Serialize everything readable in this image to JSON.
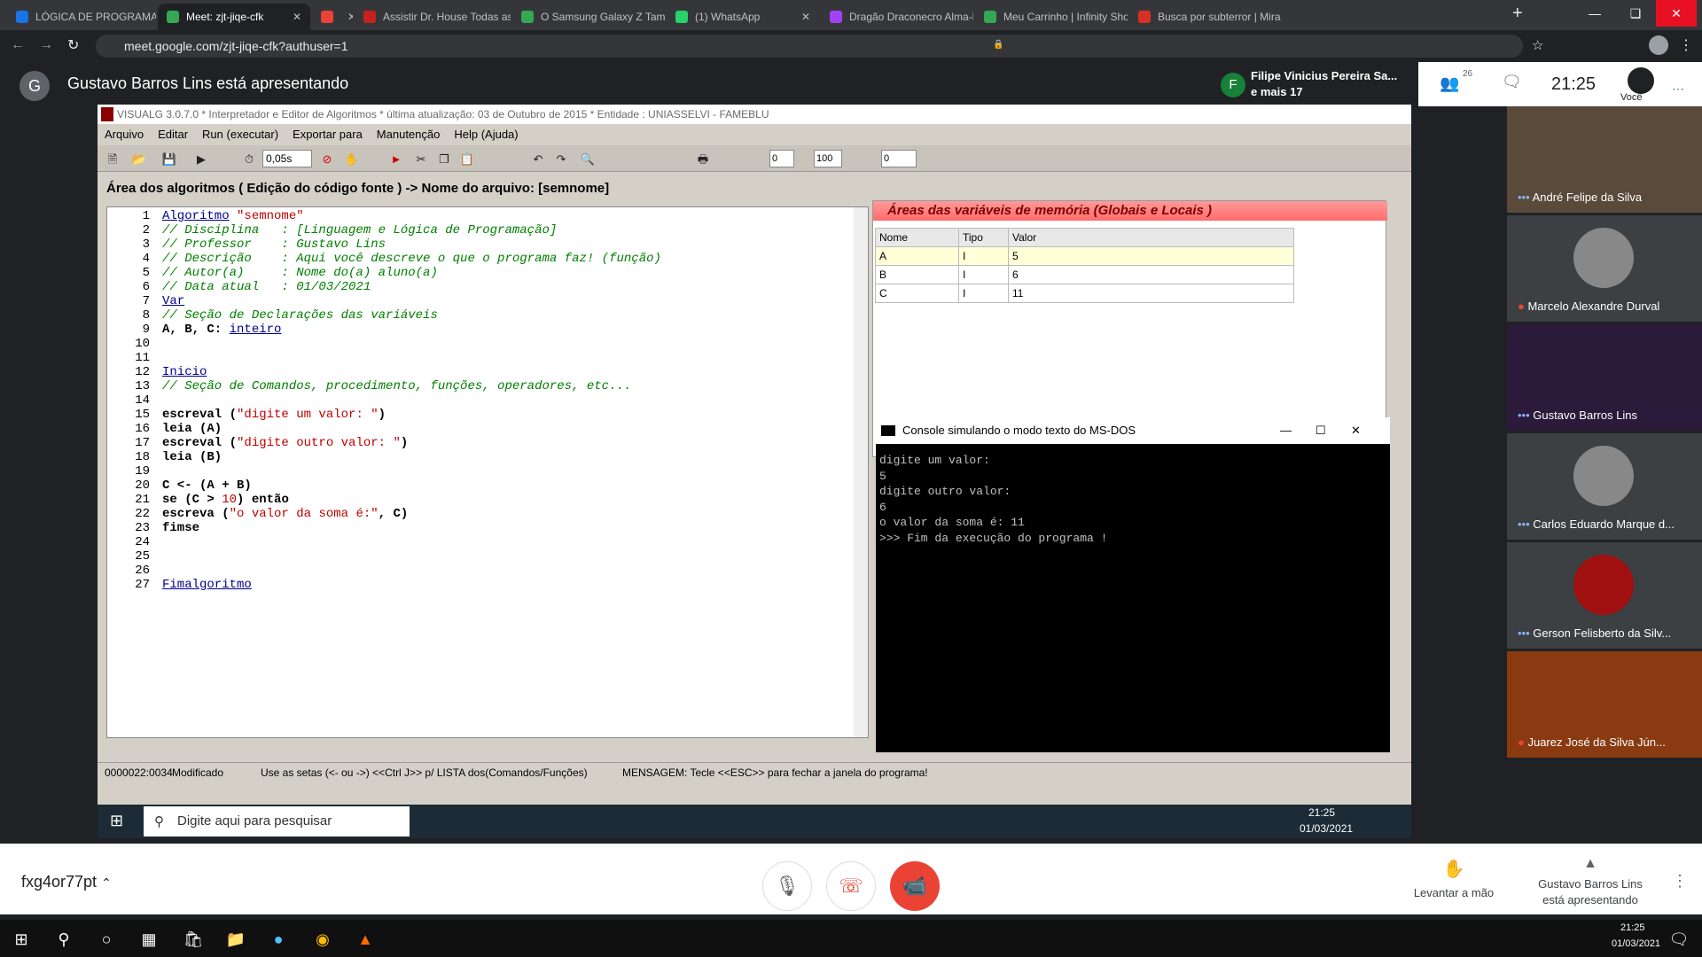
{
  "tabs": [
    {
      "label": "LÓGICA DE PROGRAMAÇÃO",
      "color": "#1a73e8"
    },
    {
      "label": "Meet: zjt-jiqe-cfk",
      "color": "#34a853"
    },
    {
      "label": "",
      "color": "#ea4335"
    },
    {
      "label": "Assistir Dr. House Todas as",
      "color": "#c5221f"
    },
    {
      "label": "O Samsung Galaxy Z Tampo",
      "color": "#34a853"
    },
    {
      "label": "(1) WhatsApp",
      "color": "#25d366"
    },
    {
      "label": "Dragão Draconecro Alma-li",
      "color": "#a142f4"
    },
    {
      "label": "Meu Carrinho | Infinity Shop",
      "color": "#34a853"
    },
    {
      "label": "Busca por subterror | Mira",
      "color": "#d93025"
    }
  ],
  "address": "meet.google.com/zjt-jiqe-cfk?authuser=1",
  "presenter": {
    "initial": "G",
    "text": "Gustavo Barros Lins está apresentando"
  },
  "notification": {
    "initial": "F",
    "line1": "Filipe Vinicius Pereira Sa...",
    "line2": "e mais 17"
  },
  "meet_top": {
    "people_count": "26",
    "time": "21:25",
    "you": "Você"
  },
  "visualg": {
    "title": "VISUALG 3.0.7.0 * Interpretador e Editor de Algoritmos * última atualização: 03 de Outubro de 2015 * Entidade : UNIASSELVI - FAMEBLU",
    "menu": [
      "Arquivo",
      "Editar",
      "Run (executar)",
      "Exportar para",
      "Manutenção",
      "Help (Ajuda)"
    ],
    "speed": "0,05s",
    "toolbar_fields": {
      "lin": "0",
      "ate": "100",
      "dec": "0"
    },
    "area_title": "Área dos algoritmos ( Edição do código fonte ) -> Nome do arquivo: [semnome]",
    "code": [
      [
        [
          "kw",
          "Algoritmo"
        ],
        [
          "st",
          " \"semnome\""
        ]
      ],
      [
        [
          "cm",
          "// Disciplina   : [Linguagem e Lógica de Programação]"
        ]
      ],
      [
        [
          "cm",
          "// Professor    : Gustavo Lins"
        ]
      ],
      [
        [
          "cm",
          "// Descrição    : Aqui você descreve o que o programa faz! (função)"
        ]
      ],
      [
        [
          "cm",
          "// Autor(a)     : Nome do(a) aluno(a)"
        ]
      ],
      [
        [
          "cm",
          "// Data atual   : 01/03/2021"
        ]
      ],
      [
        [
          "kw",
          "Var"
        ]
      ],
      [
        [
          "cm",
          "// Seção de Declarações das variáveis"
        ]
      ],
      [
        [
          "bd",
          "A, B, C: "
        ],
        [
          "kw",
          "inteiro"
        ]
      ],
      [],
      [],
      [
        [
          "kw",
          "Inicio"
        ]
      ],
      [
        [
          "cm",
          "// Seção de Comandos, procedimento, funções, operadores, etc..."
        ]
      ],
      [],
      [
        [
          "bd",
          "escreval ("
        ],
        [
          "st",
          "\"digite um valor: \""
        ],
        [
          "bd",
          ")"
        ]
      ],
      [
        [
          "bd",
          "leia (A)"
        ]
      ],
      [
        [
          "bd",
          "escreval ("
        ],
        [
          "st",
          "\"digite outro valor: \""
        ],
        [
          "bd",
          ")"
        ]
      ],
      [
        [
          "bd",
          "leia (B)"
        ]
      ],
      [],
      [
        [
          "bd",
          "C <- (A + B)"
        ]
      ],
      [
        [
          "bd",
          "se (C > "
        ],
        [
          "st",
          "10"
        ],
        [
          "bd",
          ") então"
        ]
      ],
      [
        [
          "bd",
          "escreva ("
        ],
        [
          "st",
          "\"o valor da soma é:\""
        ],
        [
          "bd",
          ", C)"
        ]
      ],
      [
        [
          "bd",
          "fimse"
        ]
      ],
      [],
      [],
      [],
      [
        [
          "kw",
          "Fimalgoritmo"
        ]
      ]
    ],
    "vars_title": "Áreas das variáveis de memória (Globais e Locais )",
    "vars_headers": [
      "Nome",
      "Tipo",
      "Valor"
    ],
    "vars": [
      [
        "A",
        "I",
        "5"
      ],
      [
        "B",
        "I",
        "6"
      ],
      [
        "C",
        "I",
        "11"
      ]
    ],
    "console_title": "Console simulando o modo texto do MS-DOS",
    "console_lines": [
      "digite um valor:",
      "5",
      "digite outro valor:",
      "6",
      "o valor da soma é: 11",
      ">>> Fim da execução do programa !"
    ],
    "status": {
      "pos": "0000022:0034",
      "state": "Modificado",
      "hint": "Use as setas (<- ou ->) <<Ctrl J>> p/ LISTA dos(Comandos/Funções)",
      "msg": "MENSAGEM: Tecle <<ESC>> para fechar a janela do programa!"
    },
    "taskbar": {
      "search": "Digite aqui para pesquisar",
      "time": "21:25",
      "date": "01/03/2021"
    }
  },
  "participants": [
    {
      "name": "André Felipe da Silva",
      "muted": false
    },
    {
      "name": "Marcelo Alexandre Durval",
      "muted": true
    },
    {
      "name": "Gustavo Barros Lins",
      "muted": false
    },
    {
      "name": "Carlos Eduardo Marque d...",
      "muted": false
    },
    {
      "name": "Gerson Felisberto da Silv...",
      "muted": false
    },
    {
      "name": "Juarez José da Silva Jún...",
      "muted": true
    }
  ],
  "bottom": {
    "code": "fxg4or77pt",
    "raise_hand": "Levantar a mão",
    "presenting_line1": "Gustavo Barros Lins",
    "presenting_line2": "está apresentando"
  },
  "os_taskbar": {
    "time": "21:25",
    "date": "01/03/2021"
  }
}
